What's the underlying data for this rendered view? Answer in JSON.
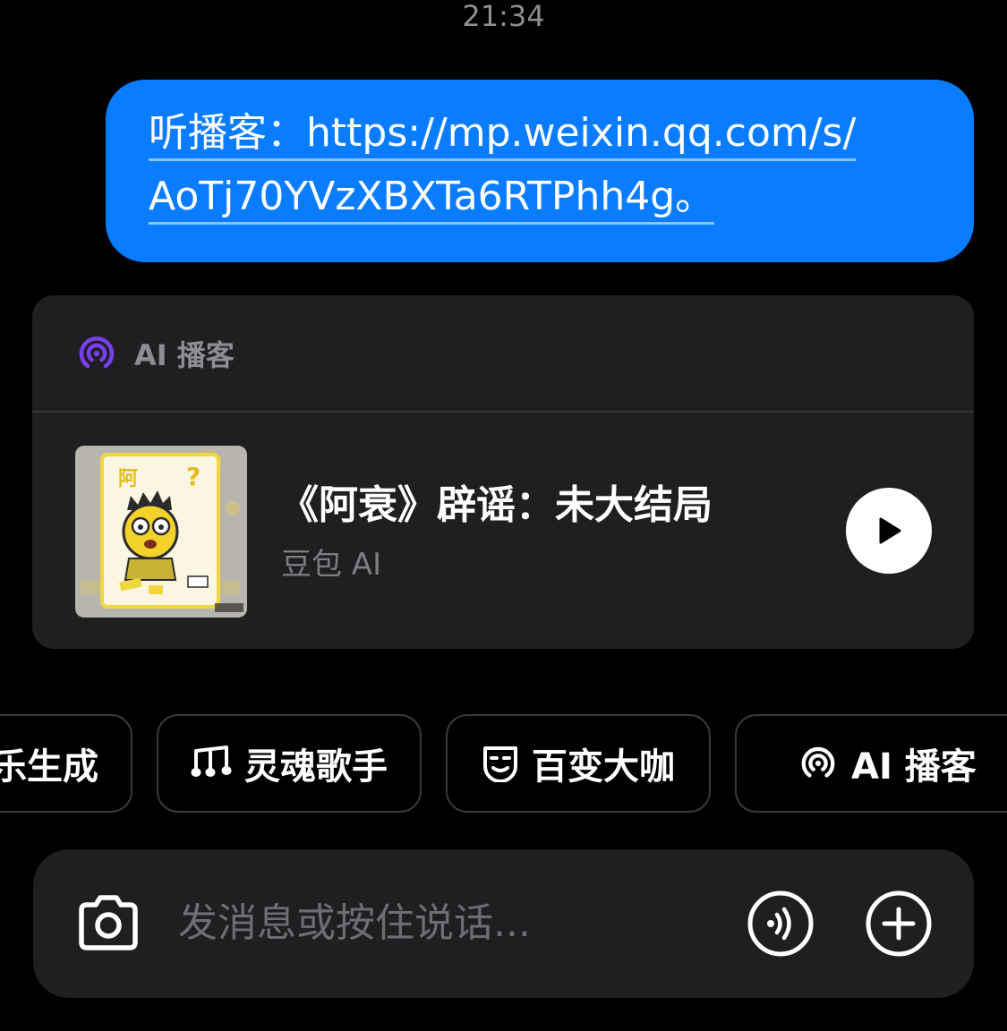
{
  "status_time": "21:34",
  "message": {
    "line1": "听播客：https://mp.weixin.qq.com/s/",
    "line2": "AoTj70YVzXBXTa6RTPhh4g。"
  },
  "podcast_card": {
    "header_label": "AI 播客",
    "title": "《阿衰》辟谣：未大结局",
    "subtitle": "豆包 AI",
    "cover_text": "阿",
    "accent_color": "#7b3ff2"
  },
  "quick_actions": [
    {
      "label": "乐生成",
      "icon": ""
    },
    {
      "label": "灵魂歌手",
      "icon": "music-notes-icon"
    },
    {
      "label": "百变大咖",
      "icon": "smiley-mask-icon"
    },
    {
      "label": "AI 播客",
      "icon": "podcast-icon"
    }
  ],
  "input": {
    "placeholder": "发消息或按住说话..."
  },
  "colors": {
    "bubble": "#0a7cff",
    "card_bg": "#1f1f21",
    "background": "#000000"
  }
}
